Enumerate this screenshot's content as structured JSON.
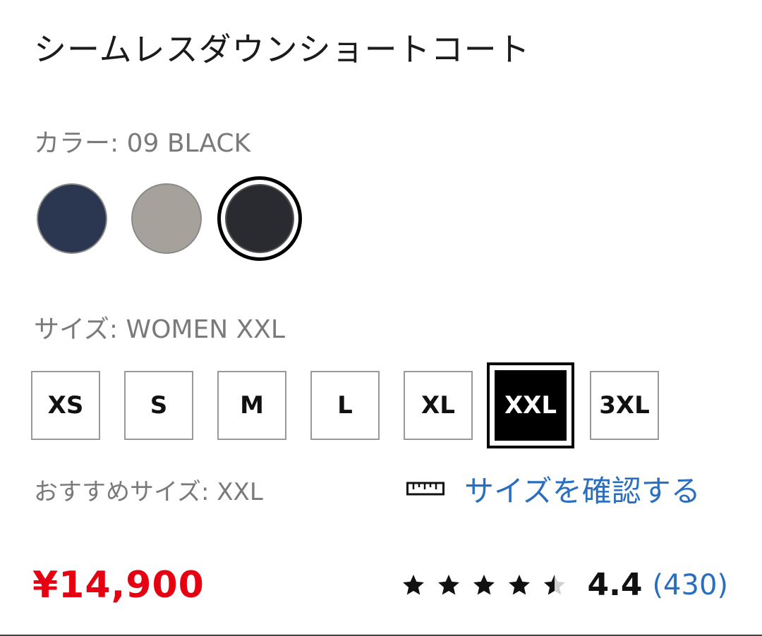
{
  "product": {
    "title": "シームレスダウンショートコート"
  },
  "color": {
    "label": "カラー: 09 BLACK",
    "swatches": [
      {
        "name": "navy",
        "hex": "#2b3650",
        "selected": false
      },
      {
        "name": "gray",
        "hex": "#a6a29b",
        "selected": false
      },
      {
        "name": "black",
        "hex": "#2a2b30",
        "selected": true
      }
    ]
  },
  "size": {
    "label": "サイズ: WOMEN XXL",
    "options": [
      "XS",
      "S",
      "M",
      "L",
      "XL",
      "XXL",
      "3XL"
    ],
    "selected": "XXL",
    "recommended_label": "おすすめサイズ: XXL",
    "check_link": "サイズを確認する",
    "ruler_icon": "ruler-icon"
  },
  "price": {
    "text": "¥14,900",
    "color": "#e60012"
  },
  "rating": {
    "value": "4.4",
    "count": "(430)",
    "stars": 4.4,
    "max_stars": 5
  },
  "colors": {
    "link": "#2a6fbf",
    "price": "#e60012"
  }
}
